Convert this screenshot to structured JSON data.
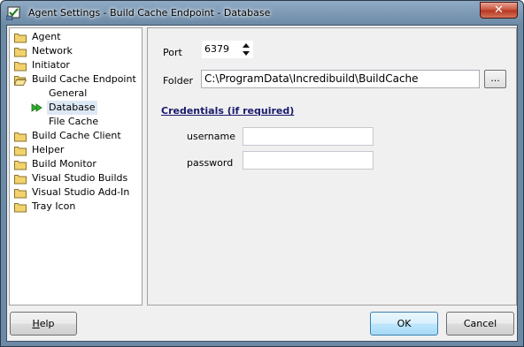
{
  "window": {
    "title": "Agent Settings - Build Cache Endpoint - Database",
    "close_glyph": "✕"
  },
  "tree": {
    "items": [
      {
        "label": "Agent",
        "icon": "folder-icon"
      },
      {
        "label": "Network",
        "icon": "folder-icon"
      },
      {
        "label": "Initiator",
        "icon": "folder-icon"
      },
      {
        "label": "Build Cache Endpoint",
        "icon": "folder-open-icon"
      },
      {
        "label": "General",
        "icon": "none"
      },
      {
        "label": "Database",
        "icon": "green-arrow-icon",
        "selected": true
      },
      {
        "label": "File Cache",
        "icon": "none"
      },
      {
        "label": "Build Cache Client",
        "icon": "folder-icon"
      },
      {
        "label": "Helper",
        "icon": "folder-icon"
      },
      {
        "label": "Build Monitor",
        "icon": "folder-icon"
      },
      {
        "label": "Visual Studio Builds",
        "icon": "folder-icon"
      },
      {
        "label": "Visual Studio Add-In",
        "icon": "folder-icon"
      },
      {
        "label": "Tray Icon",
        "icon": "folder-icon"
      }
    ]
  },
  "database": {
    "port_label": "Port",
    "port_value": "6379",
    "folder_label": "Folder",
    "folder_value": "C:\\ProgramData\\Incredibuild\\BuildCache",
    "browse_label": "...",
    "credentials_title": "Credentials (if required)",
    "username_label": "username",
    "username_value": "",
    "password_label": "password",
    "password_value": ""
  },
  "buttons": {
    "help_prefix": "",
    "help_mnemonic": "H",
    "help_rest": "elp",
    "ok": "OK",
    "cancel": "Cancel"
  },
  "colors": {
    "selected_bg": "#dde8f5",
    "frame": "#6c8aa6",
    "folder": "#f3d26b"
  }
}
